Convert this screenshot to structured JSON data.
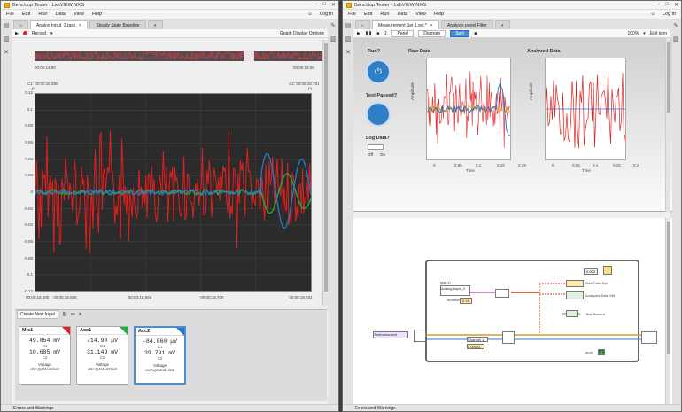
{
  "left": {
    "title": "Benchtop Tester - LabVIEW NXG",
    "menu": [
      "File",
      "Edit",
      "Run",
      "Data",
      "View",
      "Help"
    ],
    "login": "Log in",
    "tabs": [
      {
        "label": "Analog Input_2.task"
      },
      {
        "label": "Steady State Baseline"
      }
    ],
    "toolbar": {
      "record_label": "Record",
      "options_label": "Graph Display Options"
    },
    "overview_start": "00:00:14.80",
    "overview_end": "00:00:19.00",
    "cursor1": "C1: 00:00:18.580",
    "cursor2": "C2: 00:00:18.761",
    "y_ticks": [
      "0.12",
      "0.1",
      "0.08",
      "0.06",
      "0.04",
      "0.02",
      "0",
      "-0.02",
      "-0.04",
      "-0.06",
      "-0.08",
      "-0.1",
      "-0.12"
    ],
    "x_ticks": [
      "00:00:18.580",
      "00:00:18.606",
      "00:00:18.656",
      "00:00:18.706",
      "00:00:18.761"
    ],
    "create_input": "Create New Input",
    "cards": [
      {
        "name": "Mic1",
        "c1": "49.854 mV",
        "c2": "10.685 mV",
        "type": "Voltage",
        "channel": "cDAQ4Mod8/ai0",
        "color": "#e22222"
      },
      {
        "name": "Acc1",
        "c1": "714.90 μV",
        "c2": "31.149 mV",
        "type": "Voltage",
        "channel": "cDAQ4Mod7/ai0",
        "color": "#20b040"
      },
      {
        "name": "Acc2",
        "c1": "-84.060 μV",
        "c2": "39.791 mV",
        "type": "Voltage",
        "channel": "cDAQ4Mod7/ai1",
        "color": "#2b78c8"
      }
    ],
    "c1_label": "C1",
    "c2_label": "C2",
    "status": "Errors and Warnings"
  },
  "right": {
    "title": "Benchtop Tester - LabVIEW NXG",
    "menu": [
      "File",
      "Edit",
      "Run",
      "Data",
      "View",
      "Help"
    ],
    "login": "Log in",
    "tabs": [
      {
        "label": "Measurement Set 1.gvi *"
      },
      {
        "label": "Analysis panel Filter"
      }
    ],
    "view_tabs": [
      "Panel",
      "Diagram",
      "Split"
    ],
    "zoom": "100%",
    "edit_icon": "Edit icon",
    "run_label": "Run?",
    "test_label": "Test Passed?",
    "log_label": "Log Data?",
    "off_label": "Off",
    "on_label": "On",
    "raw_title": "Raw Data",
    "analyzed_title": "Analyzed Data",
    "amp_label": "Amplitude",
    "time_label": "Time",
    "raw_x_ticks": [
      "0",
      "0.05",
      "0.1",
      "0.15",
      "0.19"
    ],
    "an_x_ticks": [
      "0",
      "0.05",
      "0.1",
      "0.15",
      "0.2"
    ],
    "bd": {
      "task_in": "task in",
      "analog": "Analog Input_2",
      "duration": "duration",
      "duration_val": "0.19",
      "raw_set": "Raw Data Set",
      "analyzed_set": "Analyzed Data Set",
      "test_passed": "Test Passed",
      "const_val": "0.000",
      "test_out": "TestInstrument",
      "channel": "Channel 1",
      "chan_val": "0.00001",
      "error": "error",
      "error_val": "0"
    },
    "status": "Errors and Warnings"
  }
}
